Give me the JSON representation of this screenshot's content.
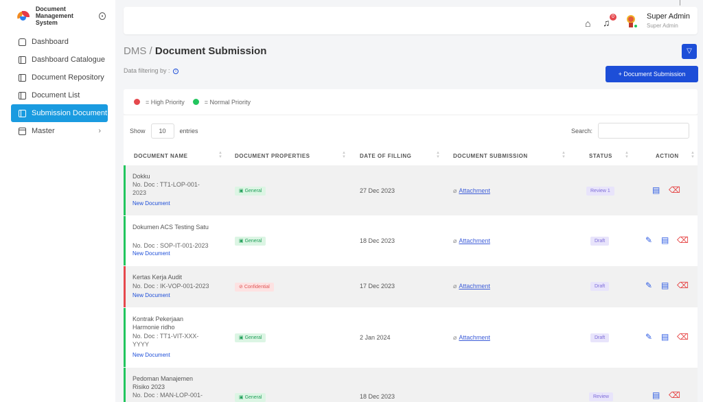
{
  "brand": {
    "name": "Document Management System"
  },
  "sidebar": {
    "items": [
      {
        "label": "Dashboard"
      },
      {
        "label": "Dashboard Catalogue"
      },
      {
        "label": "Document Repository"
      },
      {
        "label": "Document List"
      },
      {
        "label": "Submission Document"
      },
      {
        "label": "Master"
      }
    ]
  },
  "header": {
    "notification_count": "0",
    "user_name": "Super Admin",
    "user_role": "Super Admin"
  },
  "page": {
    "breadcrumb_root": "DMS",
    "breadcrumb_sep": " / ",
    "title": "Document Submission",
    "filter_label": "Data filtering by :",
    "add_button": "+ Document Submission"
  },
  "legend": {
    "high": {
      "label": "= High Priority",
      "color": "#e5484d"
    },
    "normal": {
      "label": "= Normal Priority",
      "color": "#22c55e"
    }
  },
  "table": {
    "show_label": "Show",
    "entries_value": "10",
    "entries_label": "entries",
    "search_label": "Search:",
    "columns": [
      "DOCUMENT NAME",
      "DOCUMENT PROPERTIES",
      "DATE OF FILLING",
      "DOCUMENT SUBMISSION",
      "STATUS",
      "ACTION"
    ],
    "rows": [
      {
        "name": "Dokku",
        "doc_no": "No. Doc : TT1-LOP-001-2023",
        "doc_status": "New Document",
        "property": "General",
        "date": "27 Dec 2023",
        "attachment": "Attachment",
        "status": "Review 1"
      },
      {
        "name": "Dokumen ACS Testing Satu",
        "doc_no": "No. Doc : SOP-IT-001-2023",
        "doc_status": "New Document",
        "property": "General",
        "date": "18 Dec 2023",
        "attachment": "Attachment",
        "status": "Draft"
      },
      {
        "name": "Kertas Kerja Audit",
        "doc_no": "No. Doc : IK-VOP-001-2023",
        "doc_status": "New Document",
        "property": "Confidential",
        "date": "17 Dec 2023",
        "attachment": "Attachment",
        "status": "Draft"
      },
      {
        "name": "Kontrak Pekerjaan Harmonie ridho",
        "doc_no": "No. Doc : TT1-VIT-XXX-YYYY",
        "doc_status": "New Document",
        "property": "General",
        "date": "2 Jan 2024",
        "attachment": "Attachment",
        "status": "Draft"
      },
      {
        "name": "Pedoman Manajemen Risiko 2023",
        "doc_no": "No. Doc : MAN-LOP-001-",
        "doc_status": "",
        "property": "General",
        "date": "18 Dec 2023",
        "attachment": "",
        "status": "Review"
      }
    ]
  },
  "colors": {
    "accent": "#1d4ed8",
    "sidebar_active": "#1a9be0",
    "high_priority": "#e5484d",
    "normal_priority": "#22c55e"
  }
}
